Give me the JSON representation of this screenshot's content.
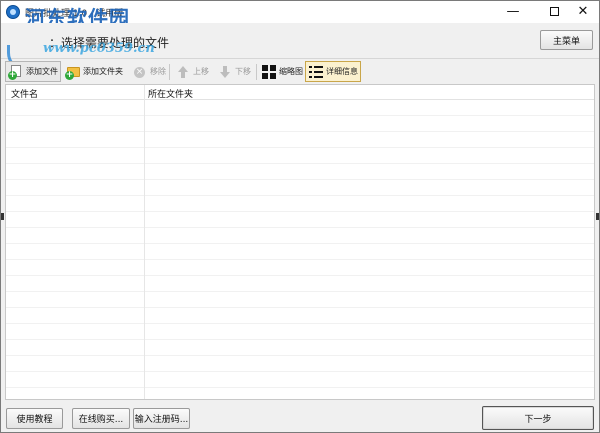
{
  "window": {
    "title": "图片批处理 1.0 - 试用版",
    "controls": {
      "minimize": "—",
      "close": "✕"
    }
  },
  "watermark": {
    "brand": "河东软件园",
    "url": "www.pc0359.cn"
  },
  "header": {
    "step_title": "：选择需要处理的文件",
    "main_menu_label": "主菜单"
  },
  "toolbar": {
    "add_file": "添加文件",
    "add_folder": "添加文件夹",
    "remove": "移除",
    "move_up": "上移",
    "move_down": "下移",
    "thumbnail_view": "缩略图",
    "detail_view": "详细信息"
  },
  "list": {
    "columns": [
      "文件名",
      "所在文件夹"
    ],
    "rows": []
  },
  "footer": {
    "tutorial": "使用教程",
    "buy_online": "在线购买...",
    "enter_code": "输入注册码...",
    "next": "下一步"
  },
  "colors": {
    "accent": "#1c63b8",
    "active_tool_bg": "#fbf1cf",
    "add_green": "#2fa83a",
    "folder_yellow": "#f2c043"
  }
}
